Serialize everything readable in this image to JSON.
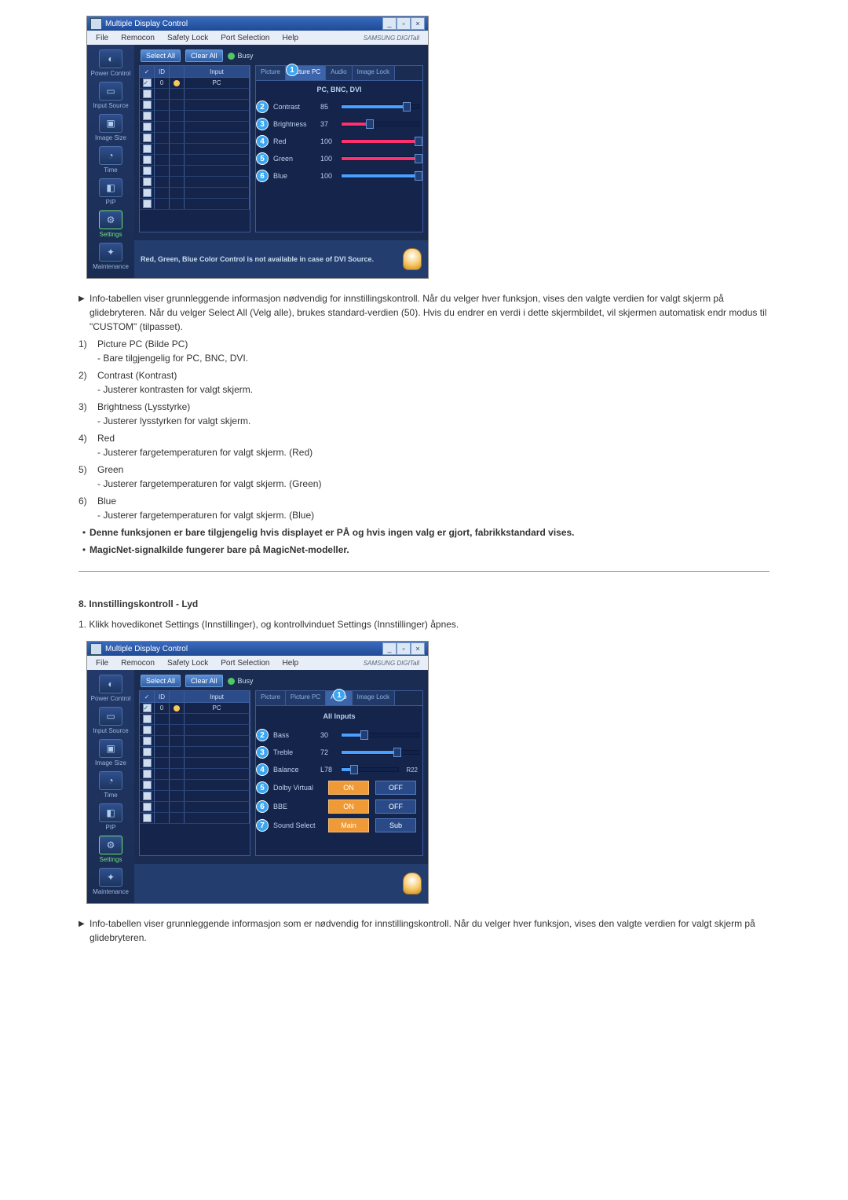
{
  "app": {
    "title": "Multiple Display Control",
    "menus": [
      "File",
      "Remocon",
      "Safety Lock",
      "Port Selection",
      "Help"
    ],
    "brand": "SAMSUNG DIGITall",
    "toolbar": {
      "selectAll": "Select All",
      "clearAll": "Clear All",
      "busy": "Busy"
    },
    "sidebar": [
      "Power Control",
      "Input Source",
      "Image Size",
      "Time",
      "PIP",
      "Settings",
      "Maintenance"
    ],
    "gridHeaders": {
      "chk": "✓",
      "id": "ID",
      "stat": " ",
      "input": "Input"
    },
    "gridFirst": {
      "id": "0",
      "input": "PC"
    }
  },
  "screenshot1": {
    "tabs": [
      "Picture",
      "Picture PC",
      "Audio",
      "Image Lock"
    ],
    "activeTab": 1,
    "subhead": "PC, BNC, DVI",
    "sliders": [
      {
        "n": 2,
        "label": "Contrast",
        "value": "85",
        "pct": 85,
        "cls": ""
      },
      {
        "n": 3,
        "label": "Brightness",
        "value": "37",
        "pct": 37,
        "cls": "fred"
      },
      {
        "n": 4,
        "label": "Red",
        "value": "100",
        "pct": 100,
        "cls": "fred"
      },
      {
        "n": 5,
        "label": "Green",
        "value": "100",
        "pct": 100,
        "cls": "fred"
      },
      {
        "n": 6,
        "label": "Blue",
        "value": "100",
        "pct": 100,
        "cls": ""
      }
    ],
    "footer": "Red, Green, Blue Color Control is not available in case of DVI Source."
  },
  "doc1": {
    "intro": "Info-tabellen viser grunnleggende informasjon nødvendig for innstillingskontroll. Når du velger hver funksjon, vises den valgte verdien for valgt skjerm på glidebryteren.\nNår du velger Select All (Velg alle), brukes standard-verdien (50).\nHvis du endrer en verdi i dette skjermbildet, vil skjermen automatisk endr modus til \"CUSTOM\" (tilpasset).",
    "items": [
      {
        "n": "1)",
        "h": "Picture PC (Bilde PC)",
        "s": "Bare tilgjengelig for PC, BNC, DVI."
      },
      {
        "n": "2)",
        "h": "Contrast (Kontrast)",
        "s": "Justerer kontrasten for valgt skjerm."
      },
      {
        "n": "3)",
        "h": "Brightness (Lysstyrke)",
        "s": "Justerer lysstyrken for valgt skjerm."
      },
      {
        "n": "4)",
        "h": "Red",
        "s": "Justerer fargetemperaturen for valgt skjerm. (Red)"
      },
      {
        "n": "5)",
        "h": "Green",
        "s": "Justerer fargetemperaturen for valgt skjerm. (Green)"
      },
      {
        "n": "6)",
        "h": "Blue",
        "s": "Justerer fargetemperaturen for valgt skjerm. (Blue)"
      }
    ],
    "bullets": [
      "Denne funksjonen er bare tilgjengelig hvis displayet er PÅ og hvis ingen valg er gjort, fabrikkstandard vises.",
      "MagicNet-signalkilde fungerer bare på MagicNet-modeller."
    ]
  },
  "section2": {
    "title": "8. Innstillingskontroll - Lyd",
    "intro": "1.  Klikk hovedikonet Settings (Innstillinger), og kontrollvinduet Settings (Innstillinger) åpnes."
  },
  "screenshot2": {
    "tabs": [
      "Picture",
      "Picture PC",
      "Audio",
      "Image Lock"
    ],
    "activeTab": 2,
    "subhead": "All Inputs",
    "sliders": [
      {
        "n": 2,
        "label": "Bass",
        "value": "30",
        "pct": 30,
        "cls": ""
      },
      {
        "n": 3,
        "label": "Treble",
        "value": "72",
        "pct": 72,
        "cls": ""
      },
      {
        "n": 4,
        "label": "Balance",
        "value": "L78",
        "pct": 22,
        "cls": "",
        "end": "R22"
      }
    ],
    "toggles": [
      {
        "n": 5,
        "label": "Dolby Virtual",
        "a": "ON",
        "b": "OFF",
        "on": 0
      },
      {
        "n": 6,
        "label": "BBE",
        "a": "ON",
        "b": "OFF",
        "on": 0
      },
      {
        "n": 7,
        "label": "Sound Select",
        "a": "Main",
        "b": "Sub",
        "on": 0
      }
    ]
  },
  "doc2": {
    "intro": "Info-tabellen viser grunnleggende informasjon som er nødvendig for innstillingskontroll. Når du velger hver funksjon, vises den valgte verdien for valgt skjerm på glidebryteren."
  }
}
